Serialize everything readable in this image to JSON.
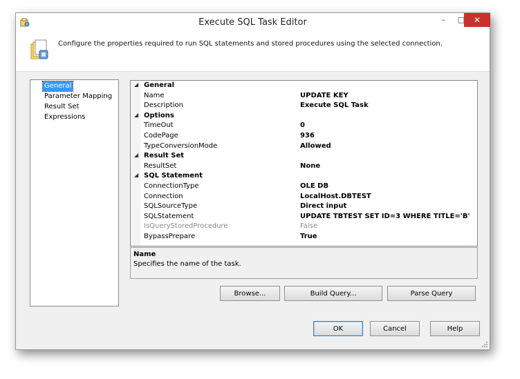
{
  "window": {
    "title": "Execute SQL Task Editor",
    "controls": {
      "minimize": "–",
      "maximize": "□",
      "close": "✕"
    },
    "close_color": "#c7312a"
  },
  "header": {
    "icon": "sql-task-icon",
    "description": "Configure the properties required to run SQL statements and stored procedures using the selected connection."
  },
  "nav": {
    "items": [
      {
        "label": "General",
        "selected": true
      },
      {
        "label": "Parameter Mapping",
        "selected": false
      },
      {
        "label": "Result Set",
        "selected": false
      },
      {
        "label": "Expressions",
        "selected": false
      }
    ],
    "selected_color": "#3399ff"
  },
  "properties": {
    "general": {
      "label": "General",
      "name": {
        "label": "Name",
        "value": "UPDATE KEY"
      },
      "description": {
        "label": "Description",
        "value": "Execute SQL Task"
      }
    },
    "options": {
      "label": "Options",
      "timeout": {
        "label": "TimeOut",
        "value": "0"
      },
      "codepage": {
        "label": "CodePage",
        "value": "936"
      },
      "type_conversion_mode": {
        "label": "TypeConversionMode",
        "value": "Allowed"
      }
    },
    "result_set": {
      "label": "Result Set",
      "resultset": {
        "label": "ResultSet",
        "value": "None"
      }
    },
    "sql_statement": {
      "label": "SQL Statement",
      "connection_type": {
        "label": "ConnectionType",
        "value": "OLE DB"
      },
      "connection": {
        "label": "Connection",
        "value": "LocalHost.DBTEST"
      },
      "sql_source_type": {
        "label": "SQLSourceType",
        "value": "Direct input"
      },
      "sql_statement": {
        "label": "SQLStatement",
        "value": "UPDATE TBTEST SET ID=3 WHERE TITLE='B'"
      },
      "is_query_stored_procedure": {
        "label": "IsQueryStoredProcedure",
        "value": "False"
      },
      "bypass_prepare": {
        "label": "BypassPrepare",
        "value": "True"
      }
    }
  },
  "description_panel": {
    "title": "Name",
    "text": "Specifies the name of the task."
  },
  "buttons": {
    "browse": "Browse...",
    "build_query": "Build Query...",
    "parse_query": "Parse Query",
    "ok": "OK",
    "cancel": "Cancel",
    "help": "Help"
  }
}
